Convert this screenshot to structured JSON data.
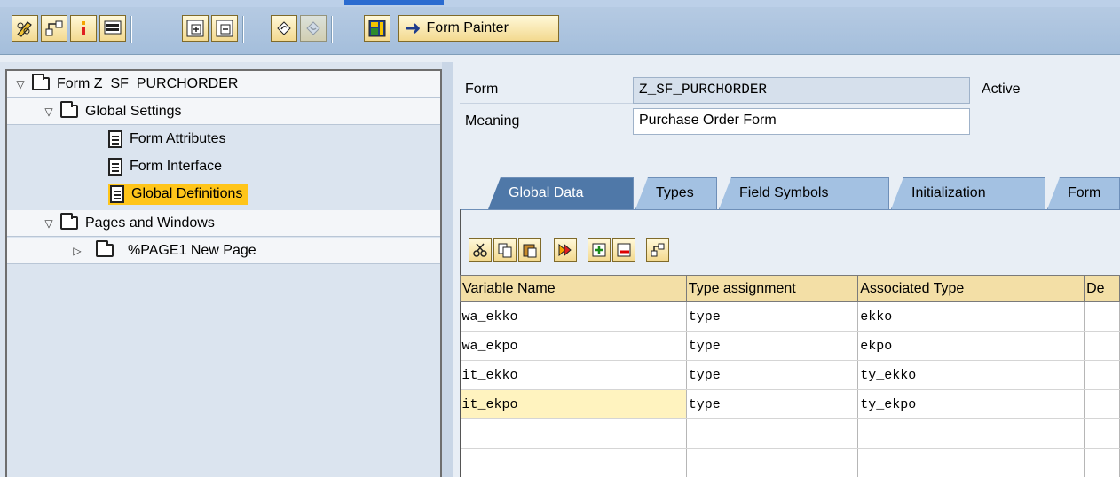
{
  "toolbar": {
    "buttons": [
      {
        "icon": "pencil-glasses-icon"
      },
      {
        "icon": "hierarchy-icon"
      },
      {
        "icon": "info-icon"
      },
      {
        "icon": "display-window-icon"
      },
      {
        "icon": "expand-subtree-icon"
      },
      {
        "icon": "collapse-subtree-icon"
      },
      {
        "icon": "undo-icon"
      },
      {
        "icon": "redo-icon"
      },
      {
        "icon": "layout-icon"
      }
    ],
    "form_painter_label": "Form Painter"
  },
  "tree": {
    "nodes": [
      {
        "label": "Form Z_SF_PURCHORDER",
        "type": "folder",
        "expanded": true,
        "level": 0
      },
      {
        "label": "Global Settings",
        "type": "folder",
        "expanded": true,
        "level": 1
      },
      {
        "label": "Form Attributes",
        "type": "doc",
        "level": 2
      },
      {
        "label": "Form Interface",
        "type": "doc",
        "level": 2
      },
      {
        "label": "Global Definitions",
        "type": "doc",
        "level": 2,
        "selected": true
      },
      {
        "label": "Pages and Windows",
        "type": "folder",
        "expanded": true,
        "level": 1
      },
      {
        "label": "%PAGE1 New Page",
        "type": "folder",
        "expanded": false,
        "level": 2
      }
    ]
  },
  "header": {
    "form_label": "Form",
    "form_value": "Z_SF_PURCHORDER",
    "status": "Active",
    "meaning_label": "Meaning",
    "meaning_value": "Purchase Order Form"
  },
  "tabs": [
    "Global Data",
    "Types",
    "Field Symbols",
    "Initialization",
    "Form"
  ],
  "active_tab": "Global Data",
  "table": {
    "columns": [
      "Variable Name",
      "Type assignment",
      "Associated Type",
      "De"
    ],
    "rows": [
      [
        "wa_ekko",
        "type",
        "ekko",
        ""
      ],
      [
        "wa_ekpo",
        "type",
        "ekpo",
        ""
      ],
      [
        "it_ekko",
        "type",
        "ty_ekko",
        ""
      ],
      [
        "it_ekpo",
        "type",
        "ty_ekpo",
        ""
      ],
      [
        "",
        "",
        "",
        ""
      ],
      [
        "",
        "",
        "",
        ""
      ]
    ]
  },
  "colors": {
    "selection": "#ffc51a",
    "header_bg": "#f3dfa6",
    "active_tab": "#4f78a8"
  }
}
